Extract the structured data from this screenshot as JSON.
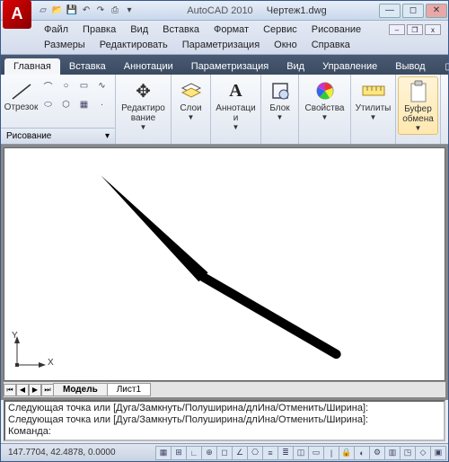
{
  "title": {
    "app": "AutoCAD 2010",
    "file": "Чертеж1.dwg"
  },
  "menu": {
    "row1": [
      "Файл",
      "Правка",
      "Вид",
      "Вставка",
      "Формат",
      "Сервис",
      "Рисование"
    ],
    "row2": [
      "Размеры",
      "Редактировать",
      "Параметризация",
      "Окно",
      "Справка"
    ]
  },
  "ribbon_tabs": [
    "Главная",
    "Вставка",
    "Аннотации",
    "Параметризация",
    "Вид",
    "Управление",
    "Вывод"
  ],
  "panels": {
    "draw": {
      "line": "Отрезок",
      "footer": "Рисование"
    },
    "edit": "Редактиро\nвание",
    "layer": "Слои",
    "annot": "Аннотаци\nи",
    "block": "Блок",
    "prop": "Свойства",
    "util": "Утилиты",
    "clip": "Буфер\nобмена"
  },
  "model_tabs": {
    "model": "Модель",
    "sheet": "Лист1"
  },
  "command": {
    "l1": "Следующая точка или [Дуга/Замкнуть/Полуширина/длИна/Отменить/Ширина]:",
    "l2": "Следующая точка или [Дуга/Замкнуть/Полуширина/длИна/Отменить/Ширина]:",
    "prompt": "Команда:"
  },
  "status": {
    "coords": "147.7704, 42.4878, 0.0000"
  },
  "axis": {
    "x": "X",
    "y": "Y"
  }
}
